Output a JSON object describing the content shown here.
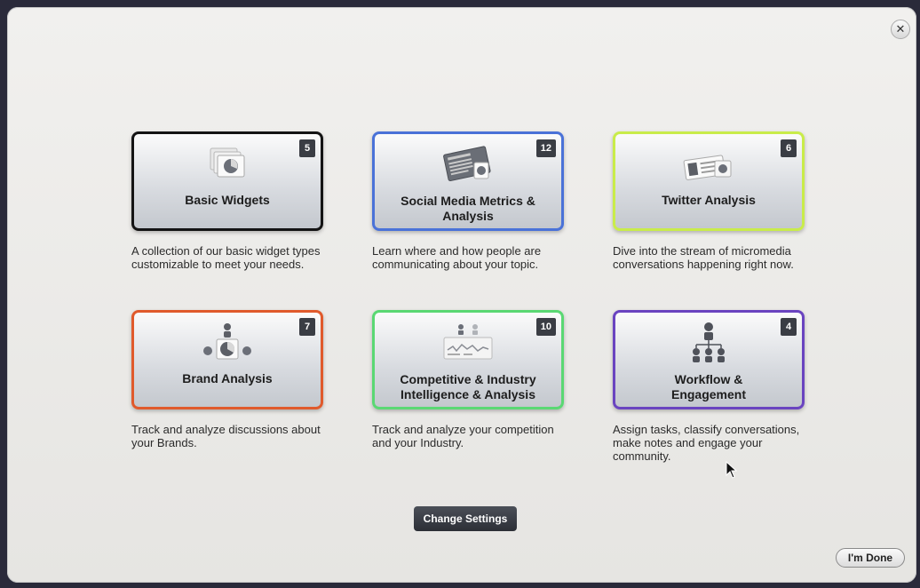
{
  "modal": {
    "close_glyph": "✕",
    "change_settings_label": "Change Settings",
    "done_label": "I'm Done"
  },
  "cards": [
    {
      "title": "Basic Widgets",
      "count": "5",
      "border": "#141414",
      "icon": "widgets-icon",
      "description": "A collection of our basic widget types customizable to meet your needs."
    },
    {
      "title": "Social Media Metrics & Analysis",
      "count": "12",
      "border": "#4a72d8",
      "icon": "news-icon",
      "description": "Learn where and how people are communicating about your topic."
    },
    {
      "title": "Twitter Analysis",
      "count": "6",
      "border": "#c9ec4a",
      "icon": "twitter-cards-icon",
      "description": "Dive into the stream of micromedia conversations happening right now."
    },
    {
      "title": "Brand Analysis",
      "count": "7",
      "border": "#e05a2c",
      "icon": "brand-icon",
      "description": "Track and analyze discussions about your Brands."
    },
    {
      "title": "Competitive & Industry Intelligence & Analysis",
      "count": "10",
      "border": "#5ad873",
      "icon": "dashboard-icon",
      "description": "Track and analyze your competition and your Industry."
    },
    {
      "title": "Workflow & Engagement",
      "count": "4",
      "border": "#6a44c0",
      "icon": "org-chart-icon",
      "description": "Assign tasks, classify conversations, make notes and engage your community."
    }
  ]
}
